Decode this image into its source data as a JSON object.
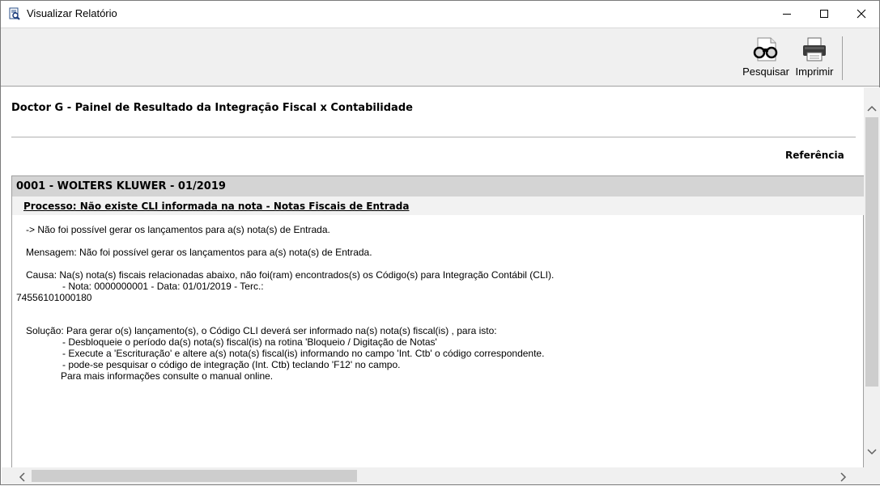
{
  "window": {
    "title": "Visualizar Relatório"
  },
  "toolbar": {
    "search_label": "Pesquisar",
    "print_label": "Imprimir"
  },
  "report": {
    "title": "Doctor G - Painel de Resultado da Integração Fiscal x Contabilidade",
    "reference_label": "Referência",
    "section_title": "0001 - WOLTERS KLUWER - 01/2019",
    "process_title": "Processo: Não existe CLI informada na nota - Notas Fiscais de Entrada",
    "lines": {
      "l1": "-> Não foi possível gerar os lançamentos para a(s) nota(s) de Entrada.",
      "l2": "Mensagem: Não foi possível gerar os lançamentos para a(s) nota(s) de Entrada.",
      "l3": "Causa: Na(s) nota(s) fiscais relacionadas abaixo, não foi(ram) encontrados(s) os Código(s) para Integração Contábil (CLI).",
      "l4": "- Nota: 0000000001 - Data: 01/01/2019 - Terc.:",
      "l5": "74556101000180",
      "l6": "Solução: Para gerar o(s) lançamento(s), o Código CLI deverá ser informado na(s) nota(s) fiscal(is) , para isto:",
      "l7": "- Desbloqueie o período da(s) nota(s) fiscal(is) na rotina 'Bloqueio / Digitação de Notas'",
      "l8": "- Execute a 'Escrituração' e altere a(s) nota(s) fiscal(is) informando no campo 'Int. Ctb' o código correspondente.",
      "l9": "- pode-se pesquisar o código de integração (Int. Ctb) teclando 'F12' no campo.",
      "l10": "Para mais informações consulte o manual online."
    }
  }
}
